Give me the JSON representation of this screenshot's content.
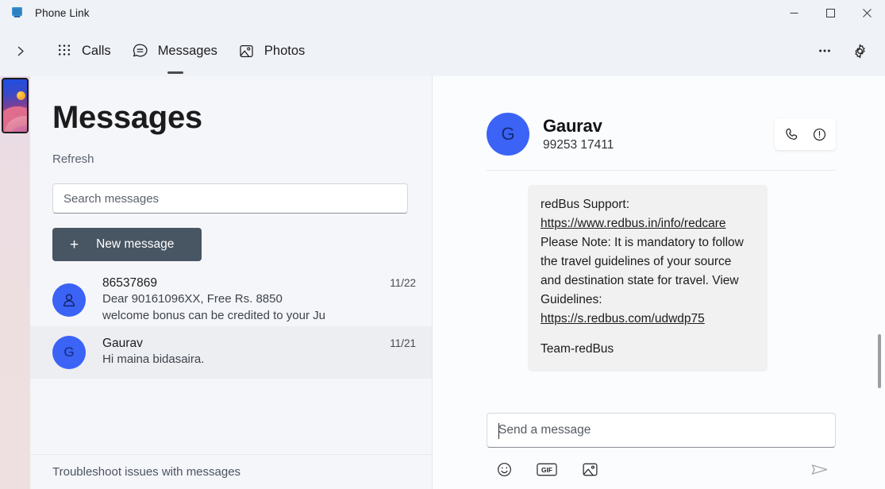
{
  "window": {
    "title": "Phone Link",
    "app_icon": "phone-link-icon",
    "minimize_label": "Minimize",
    "maximize_label": "Maximize",
    "close_label": "Close"
  },
  "nav": {
    "expand_label": "Expand",
    "tabs": [
      {
        "label": "Calls",
        "icon": "dialpad-icon",
        "active": false
      },
      {
        "label": "Messages",
        "icon": "message-bubble-icon",
        "active": true
      },
      {
        "label": "Photos",
        "icon": "photo-icon",
        "active": false
      }
    ],
    "more_label": "See more",
    "settings_label": "Settings"
  },
  "rail": {
    "device_thumb_label": "Connected phone"
  },
  "list": {
    "title": "Messages",
    "refresh_label": "Refresh",
    "search_placeholder": "Search messages",
    "search_value": "",
    "new_message_label": "New message",
    "new_message_plus": "+",
    "troubleshoot_label": "Troubleshoot issues with messages",
    "conversations": [
      {
        "avatar_initial": "",
        "avatar_icon": "person-icon",
        "name": "86537869",
        "date": "11/22",
        "snippet_line1": "Dear 90161096XX, Free Rs. 8850",
        "snippet_line2": "welcome bonus can be credited to your Ju",
        "selected": false
      },
      {
        "avatar_initial": "G",
        "avatar_icon": "",
        "name": "Gaurav",
        "date": "11/21",
        "snippet_line1": "Hi maina bidasaira.",
        "snippet_line2": "",
        "selected": true
      }
    ]
  },
  "conversation": {
    "avatar_initial": "G",
    "contact_name": "Gaurav",
    "contact_phone": "99253 17411",
    "call_label": "Call",
    "info_label": "Contact info",
    "message": {
      "intro": "redBus Support: ",
      "link1": "https://www.redbus.in/info/redcare",
      "body": "Please Note: It is mandatory to follow the travel guidelines of your source and destination state for travel. View Guidelines: ",
      "link2": "https://s.redbus.com/udwdp75",
      "signature": "Team-redBus"
    },
    "composer_placeholder": "Send a message",
    "composer_value": "",
    "emoji_label": "Emoji",
    "gif_label": "GIF",
    "image_label": "Insert image",
    "send_label": "Send"
  },
  "colors": {
    "accent_blue": "#3b63f6",
    "button_dark": "#485563",
    "window_bg": "#eff2f7",
    "list_bg": "#f5f6f9",
    "bubble_bg": "#f1f1f2"
  }
}
